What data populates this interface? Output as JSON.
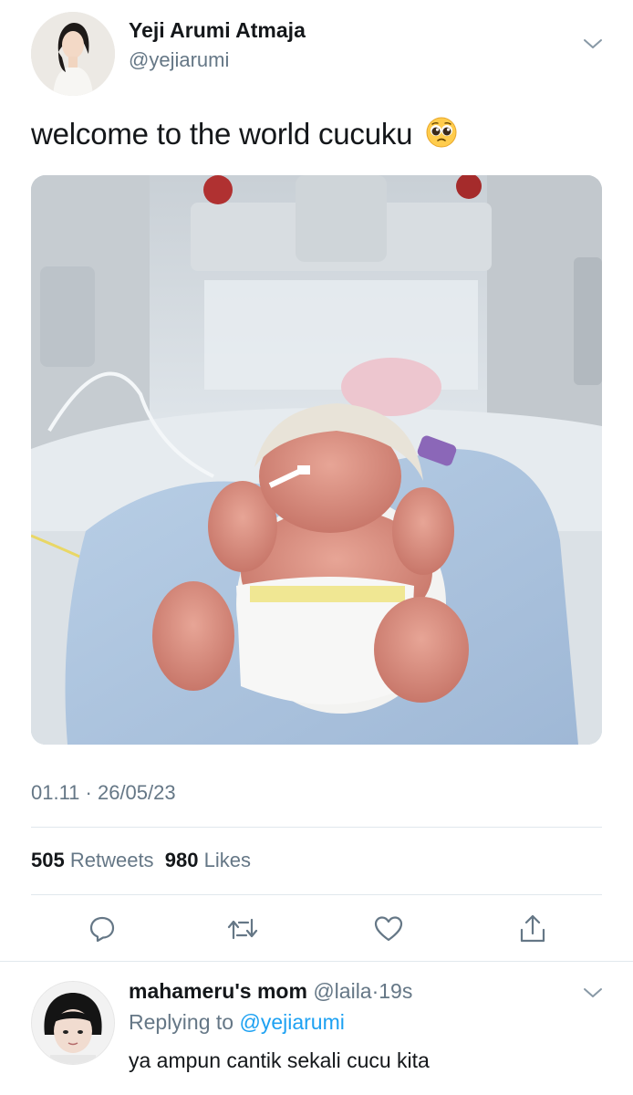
{
  "tweet": {
    "author_name": "Yeji Arumi Atmaja",
    "author_handle": "@yejiarumi",
    "text": "welcome to the world cucuku",
    "emoji_icon": "pleading-face-emoji",
    "timestamp": "01.11 · 26/05/23",
    "retweets_count": "505",
    "retweets_label": "Retweets",
    "likes_count": "980",
    "likes_label": "Likes",
    "actions": [
      "reply-icon",
      "retweet-icon",
      "like-icon",
      "share-icon"
    ]
  },
  "reply": {
    "author_name": "mahameru's mom",
    "author_handle": "@laila",
    "separator": "·",
    "time": "19s",
    "replying_prefix": "Replying to",
    "replying_to": "@yejiarumi",
    "text": "ya ampun cantik sekali cucu kita"
  },
  "colors": {
    "text": "#14171a",
    "secondary": "#657786",
    "link": "#1da1f2",
    "divider": "#e1e8ed"
  }
}
